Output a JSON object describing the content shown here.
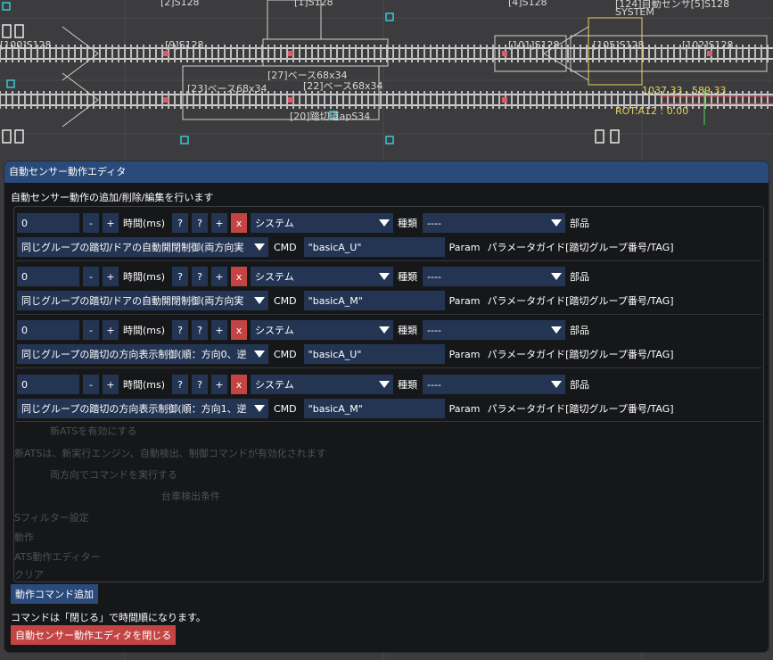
{
  "background": {
    "labels": [
      {
        "id": "l1",
        "text": "[2]S128"
      },
      {
        "id": "l2",
        "text": "[1]S128"
      },
      {
        "id": "l3",
        "text": "[4]S128"
      },
      {
        "id": "l4",
        "text": "[124]自動センサ[5]S128"
      },
      {
        "id": "l5",
        "text": "SYSTEM"
      },
      {
        "id": "l6",
        "text": "[100]S128"
      },
      {
        "id": "l7",
        "text": "[9]S128"
      },
      {
        "id": "l8",
        "text": "[101]S128"
      },
      {
        "id": "l9",
        "text": "[105]S128"
      },
      {
        "id": "l10",
        "text": "[102]S128"
      },
      {
        "id": "l11",
        "text": "[27]ベース68x34"
      },
      {
        "id": "l12",
        "text": "[22]ベース68x34"
      },
      {
        "id": "l13",
        "text": "[23]ベース68x34"
      },
      {
        "id": "l14",
        "text": "[20]踏切道apS34"
      },
      {
        "id": "l15",
        "text": "1037.33 , 589.33"
      },
      {
        "id": "l16",
        "text": "ROT:A12 : 0.00"
      }
    ],
    "ghost_texts": [
      {
        "id": "g1",
        "text": "新ATSを有効にする"
      },
      {
        "id": "g2",
        "text": "新ATSは、新実行エンジン、自動検出、制御コマンドが有効化されます"
      },
      {
        "id": "g3",
        "text": "両方向でコマンドを実行する"
      },
      {
        "id": "g4",
        "text": "台車検出条件"
      },
      {
        "id": "g5",
        "text": "Sフィルター設定"
      },
      {
        "id": "g6",
        "text": "動作"
      },
      {
        "id": "g7",
        "text": "ATS動作エディター"
      },
      {
        "id": "g8",
        "text": "クリア"
      }
    ]
  },
  "dialog": {
    "title": "自動センサー動作エディタ",
    "description": "自動センサー動作の追加/削除/編集を行います",
    "labels": {
      "minus": "-",
      "plus": "+",
      "time": "時間(ms)",
      "help1": "?",
      "help2": "?",
      "add": "+",
      "remove": "x",
      "kind": "種類",
      "part": "部品",
      "cmd": "CMD",
      "param": "Param"
    },
    "actions": [
      {
        "time": "0",
        "category": "システム",
        "type": "----",
        "command": "同じグループの踏切/ドアの自動開閉制御(両方向実",
        "cmd_value": "\"basicA_U\"",
        "param_guide": "パラメータガイド[踏切グループ番号/TAG]"
      },
      {
        "time": "0",
        "category": "システム",
        "type": "----",
        "command": "同じグループの踏切/ドアの自動開閉制御(両方向実",
        "cmd_value": "\"basicA_M\"",
        "param_guide": "パラメータガイド[踏切グループ番号/TAG]"
      },
      {
        "time": "0",
        "category": "システム",
        "type": "----",
        "command": "同じグループの踏切の方向表示制御(順：方向0、逆",
        "cmd_value": "\"basicA_U\"",
        "param_guide": "パラメータガイド[踏切グループ番号/TAG]"
      },
      {
        "time": "0",
        "category": "システム",
        "type": "----",
        "command": "同じグループの踏切の方向表示制御(順：方向1、逆",
        "cmd_value": "\"basicA_M\"",
        "param_guide": "パラメータガイド[踏切グループ番号/TAG]"
      }
    ],
    "add_command_label": "動作コマンド追加",
    "note": "コマンドは「閉じる」で時間順になります。",
    "close_label": "自動センサー動作エディタを閉じる"
  },
  "colors": {
    "accent": "#294a7a",
    "field": "#243554",
    "danger": "#c44444",
    "track_marker": "#e0586a",
    "node_marker": "#39c6d6",
    "status_text": "#e6d25a"
  }
}
